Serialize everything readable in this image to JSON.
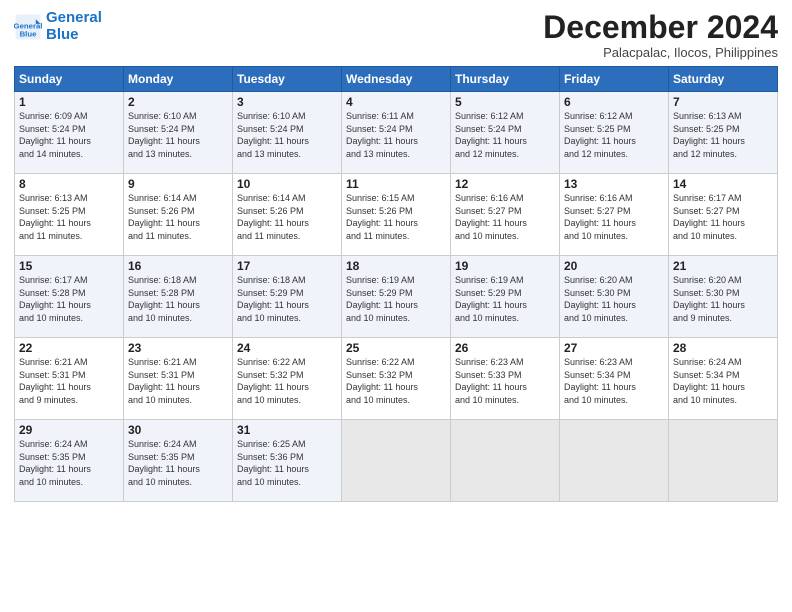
{
  "header": {
    "logo_line1": "General",
    "logo_line2": "Blue",
    "month": "December 2024",
    "location": "Palacpalac, Ilocos, Philippines"
  },
  "days_of_week": [
    "Sunday",
    "Monday",
    "Tuesday",
    "Wednesday",
    "Thursday",
    "Friday",
    "Saturday"
  ],
  "weeks": [
    [
      {
        "day": "1",
        "info": "Sunrise: 6:09 AM\nSunset: 5:24 PM\nDaylight: 11 hours\nand 14 minutes."
      },
      {
        "day": "2",
        "info": "Sunrise: 6:10 AM\nSunset: 5:24 PM\nDaylight: 11 hours\nand 13 minutes."
      },
      {
        "day": "3",
        "info": "Sunrise: 6:10 AM\nSunset: 5:24 PM\nDaylight: 11 hours\nand 13 minutes."
      },
      {
        "day": "4",
        "info": "Sunrise: 6:11 AM\nSunset: 5:24 PM\nDaylight: 11 hours\nand 13 minutes."
      },
      {
        "day": "5",
        "info": "Sunrise: 6:12 AM\nSunset: 5:24 PM\nDaylight: 11 hours\nand 12 minutes."
      },
      {
        "day": "6",
        "info": "Sunrise: 6:12 AM\nSunset: 5:25 PM\nDaylight: 11 hours\nand 12 minutes."
      },
      {
        "day": "7",
        "info": "Sunrise: 6:13 AM\nSunset: 5:25 PM\nDaylight: 11 hours\nand 12 minutes."
      }
    ],
    [
      {
        "day": "8",
        "info": "Sunrise: 6:13 AM\nSunset: 5:25 PM\nDaylight: 11 hours\nand 11 minutes."
      },
      {
        "day": "9",
        "info": "Sunrise: 6:14 AM\nSunset: 5:26 PM\nDaylight: 11 hours\nand 11 minutes."
      },
      {
        "day": "10",
        "info": "Sunrise: 6:14 AM\nSunset: 5:26 PM\nDaylight: 11 hours\nand 11 minutes."
      },
      {
        "day": "11",
        "info": "Sunrise: 6:15 AM\nSunset: 5:26 PM\nDaylight: 11 hours\nand 11 minutes."
      },
      {
        "day": "12",
        "info": "Sunrise: 6:16 AM\nSunset: 5:27 PM\nDaylight: 11 hours\nand 10 minutes."
      },
      {
        "day": "13",
        "info": "Sunrise: 6:16 AM\nSunset: 5:27 PM\nDaylight: 11 hours\nand 10 minutes."
      },
      {
        "day": "14",
        "info": "Sunrise: 6:17 AM\nSunset: 5:27 PM\nDaylight: 11 hours\nand 10 minutes."
      }
    ],
    [
      {
        "day": "15",
        "info": "Sunrise: 6:17 AM\nSunset: 5:28 PM\nDaylight: 11 hours\nand 10 minutes."
      },
      {
        "day": "16",
        "info": "Sunrise: 6:18 AM\nSunset: 5:28 PM\nDaylight: 11 hours\nand 10 minutes."
      },
      {
        "day": "17",
        "info": "Sunrise: 6:18 AM\nSunset: 5:29 PM\nDaylight: 11 hours\nand 10 minutes."
      },
      {
        "day": "18",
        "info": "Sunrise: 6:19 AM\nSunset: 5:29 PM\nDaylight: 11 hours\nand 10 minutes."
      },
      {
        "day": "19",
        "info": "Sunrise: 6:19 AM\nSunset: 5:29 PM\nDaylight: 11 hours\nand 10 minutes."
      },
      {
        "day": "20",
        "info": "Sunrise: 6:20 AM\nSunset: 5:30 PM\nDaylight: 11 hours\nand 10 minutes."
      },
      {
        "day": "21",
        "info": "Sunrise: 6:20 AM\nSunset: 5:30 PM\nDaylight: 11 hours\nand 9 minutes."
      }
    ],
    [
      {
        "day": "22",
        "info": "Sunrise: 6:21 AM\nSunset: 5:31 PM\nDaylight: 11 hours\nand 9 minutes."
      },
      {
        "day": "23",
        "info": "Sunrise: 6:21 AM\nSunset: 5:31 PM\nDaylight: 11 hours\nand 10 minutes."
      },
      {
        "day": "24",
        "info": "Sunrise: 6:22 AM\nSunset: 5:32 PM\nDaylight: 11 hours\nand 10 minutes."
      },
      {
        "day": "25",
        "info": "Sunrise: 6:22 AM\nSunset: 5:32 PM\nDaylight: 11 hours\nand 10 minutes."
      },
      {
        "day": "26",
        "info": "Sunrise: 6:23 AM\nSunset: 5:33 PM\nDaylight: 11 hours\nand 10 minutes."
      },
      {
        "day": "27",
        "info": "Sunrise: 6:23 AM\nSunset: 5:34 PM\nDaylight: 11 hours\nand 10 minutes."
      },
      {
        "day": "28",
        "info": "Sunrise: 6:24 AM\nSunset: 5:34 PM\nDaylight: 11 hours\nand 10 minutes."
      }
    ],
    [
      {
        "day": "29",
        "info": "Sunrise: 6:24 AM\nSunset: 5:35 PM\nDaylight: 11 hours\nand 10 minutes."
      },
      {
        "day": "30",
        "info": "Sunrise: 6:24 AM\nSunset: 5:35 PM\nDaylight: 11 hours\nand 10 minutes."
      },
      {
        "day": "31",
        "info": "Sunrise: 6:25 AM\nSunset: 5:36 PM\nDaylight: 11 hours\nand 10 minutes."
      },
      {
        "day": "",
        "info": ""
      },
      {
        "day": "",
        "info": ""
      },
      {
        "day": "",
        "info": ""
      },
      {
        "day": "",
        "info": ""
      }
    ]
  ]
}
